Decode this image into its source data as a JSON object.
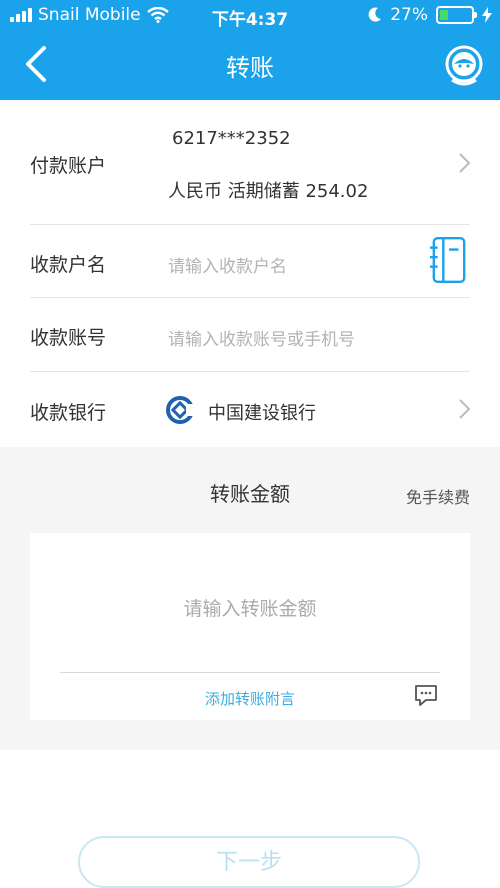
{
  "status_bar": {
    "carrier": "Snail Mobile",
    "time": "下午4:37",
    "battery": "27%",
    "battery_level": 0.27
  },
  "nav": {
    "title": "转账",
    "back_icon": "chevron-left-icon",
    "service_icon": "customer-service-icon"
  },
  "payer": {
    "label": "付款账户",
    "account_number": "6217***2352",
    "account_desc": "人民币 活期储蓄 254.02"
  },
  "payee_name": {
    "label": "收款户名",
    "placeholder": "请输入收款户名",
    "icon": "contacts-book-icon"
  },
  "payee_account": {
    "label": "收款账号",
    "placeholder": "请输入收款账号或手机号"
  },
  "payee_bank": {
    "label": "收款银行",
    "bank_name": "中国建设银行",
    "icon": "ccb-logo-icon"
  },
  "amount": {
    "title": "转账金额",
    "fee_note": "免手续费",
    "placeholder": "请输入转账金额",
    "add_note": "添加转账附言",
    "note_icon": "message-icon"
  },
  "actions": {
    "next": "下一步"
  },
  "colors": {
    "accent": "#1aa2ea",
    "link": "#3aaee0"
  }
}
